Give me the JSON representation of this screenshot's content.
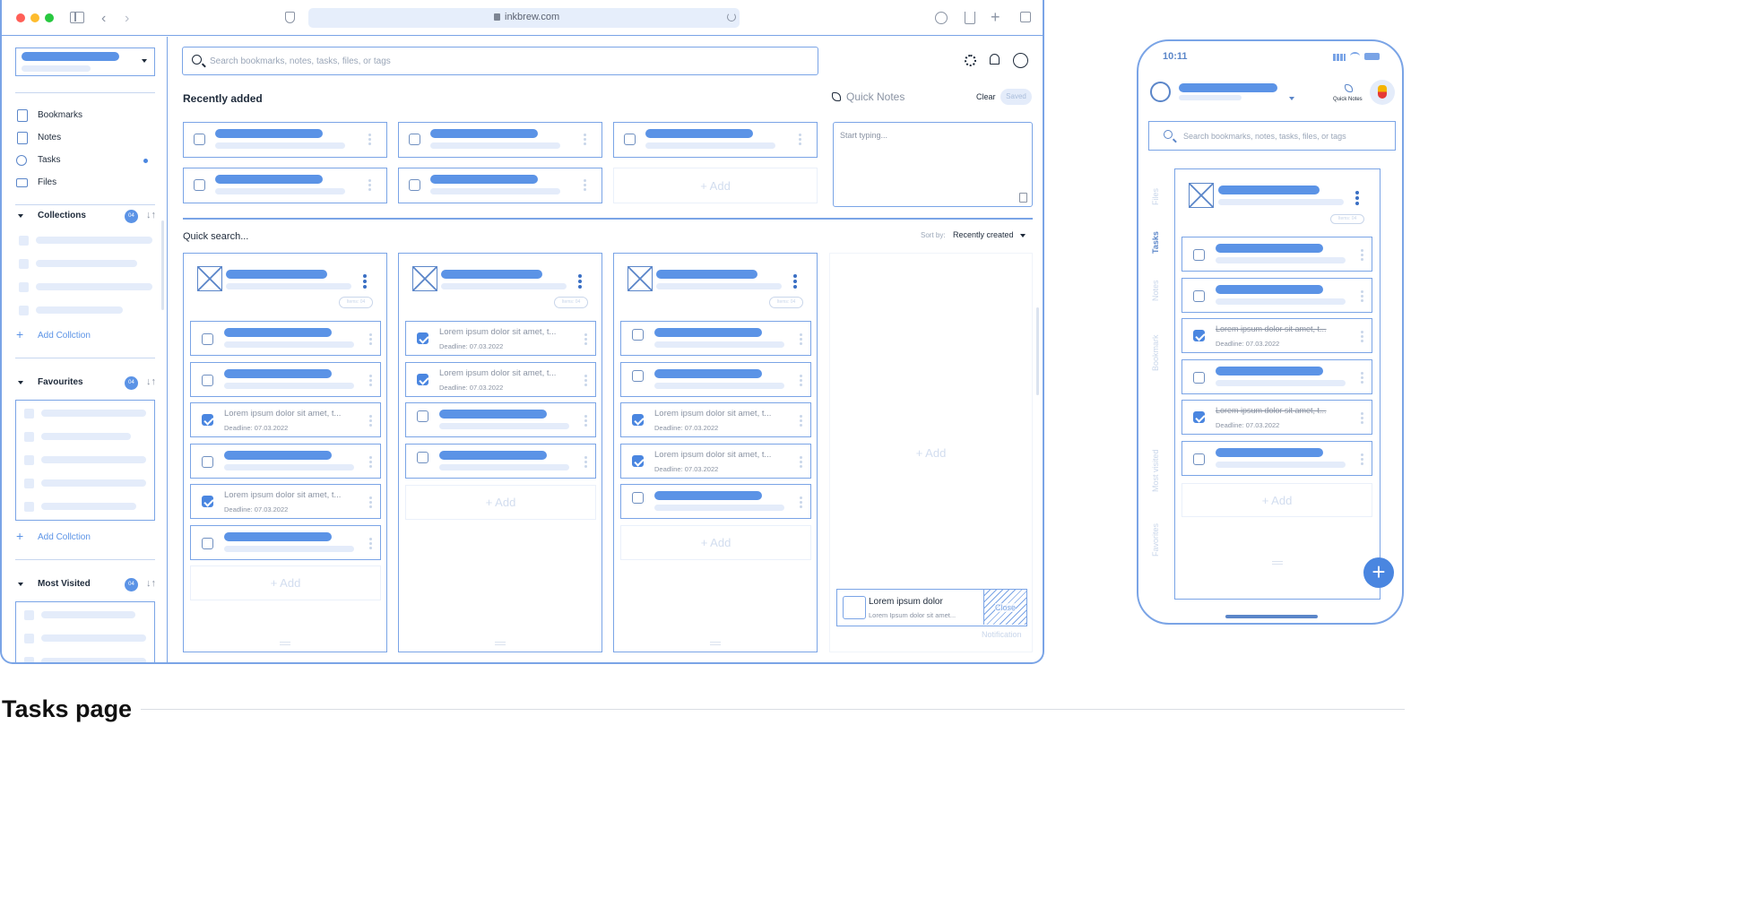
{
  "browser": {
    "url": "inkbrew.com"
  },
  "search": {
    "placeholder": "Search bookmarks, notes, tasks, files, or tags"
  },
  "sidebar": {
    "nav": [
      {
        "label": "Bookmarks"
      },
      {
        "label": "Notes"
      },
      {
        "label": "Tasks"
      },
      {
        "label": "Files"
      }
    ],
    "collections": {
      "title": "Collections",
      "badge": "04",
      "add_label": "Add Collction"
    },
    "favourites": {
      "title": "Favourites",
      "badge": "04",
      "add_label": "Add Collction"
    },
    "most_visited": {
      "title": "Most Visited",
      "badge": "04"
    }
  },
  "recent": {
    "title": "Recently added",
    "add_label": "+ Add"
  },
  "quick_notes": {
    "title": "Quick Notes",
    "clear_label": "Clear",
    "saved_label": "Saved",
    "placeholder": "Start typing..."
  },
  "quick_search": {
    "title": "Quick search...",
    "sort_by": "Sort by:",
    "sort_value": "Recently created"
  },
  "task_text": {
    "title": "Lorem ipsum dolor sit amet, t...",
    "deadline": "Deadline: 07.03.2022",
    "items_badge": "Items: 04",
    "add_label": "+ Add"
  },
  "notification": {
    "title": "Lorem ipsum dolor",
    "body": "Lorem Ipsum dolor sit amet...",
    "close_label": "Close",
    "caption": "Notification"
  },
  "mobile": {
    "time": "10:11",
    "quick_notes_label": "Quick Notes",
    "search_placeholder": "Search bookmarks, notes, tasks, files, or tags",
    "side_tabs": [
      "Files",
      "Tasks",
      "Notes",
      "Bookmark",
      "Most visited",
      "Favorites"
    ]
  },
  "page_caption": "Tasks page",
  "colors": {
    "accent": "#5b93e6",
    "border": "#7aa4e6",
    "pale": "#e4ecfa"
  }
}
